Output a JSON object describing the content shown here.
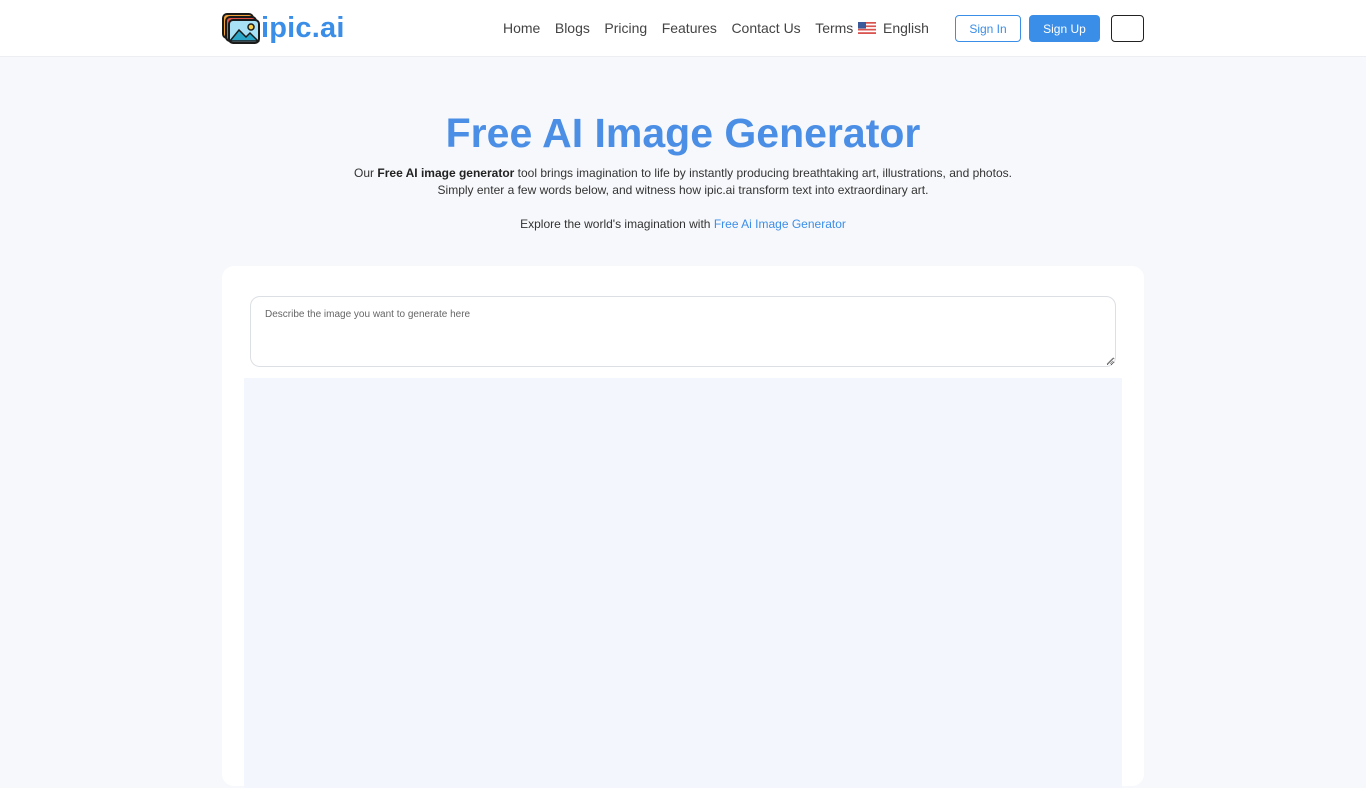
{
  "header": {
    "logo_text": "ipic.ai",
    "nav": [
      {
        "label": "Home"
      },
      {
        "label": "Blogs"
      },
      {
        "label": "Pricing"
      },
      {
        "label": "Features"
      },
      {
        "label": "Contact Us"
      },
      {
        "label": "Terms"
      }
    ],
    "language": {
      "label": "English",
      "flag_icon": "us-flag-icon"
    },
    "sign_in_label": "Sign In",
    "sign_up_label": "Sign Up",
    "menu_icon": "menu-toggle-icon"
  },
  "hero": {
    "title": "Free AI Image Generator",
    "desc_prefix": "Our ",
    "desc_bold": "Free AI image generator",
    "desc_rest": " tool brings imagination to life by instantly producing breathtaking art, illustrations, and photos.",
    "desc_line2": "Simply enter a few words below, and witness how ipic.ai transform text into extraordinary art.",
    "explore_prefix": "Explore the world's imagination with ",
    "explore_link": "Free Ai Image Generator"
  },
  "generator": {
    "prompt_placeholder": "Describe the image you want to generate here",
    "prompt_value": ""
  },
  "colors": {
    "accent": "#3b8ee8",
    "title": "#4a8ee6",
    "page_background": "#f7f8fb",
    "preview_background": "#f3f6fc"
  }
}
